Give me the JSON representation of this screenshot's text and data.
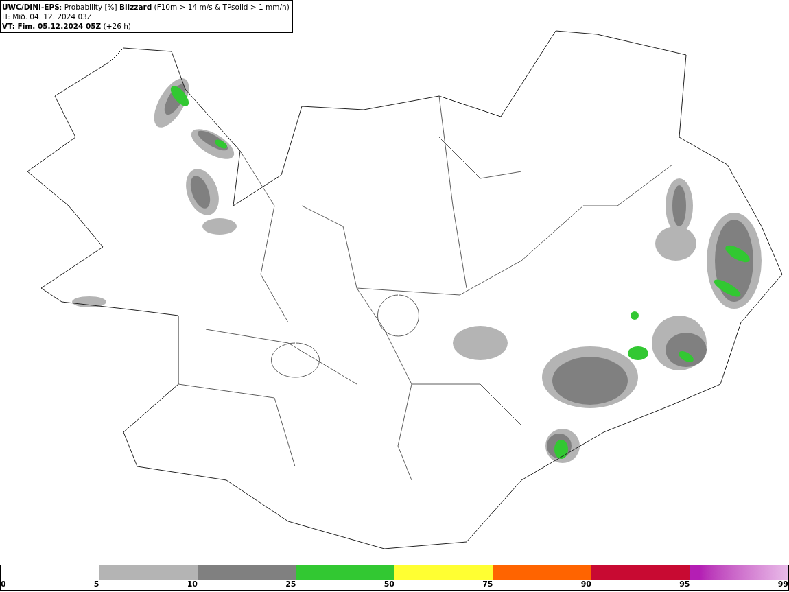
{
  "header": {
    "lines": [
      "**UWC/DINI-EPS**: Probability [%] **Blizzard** (F10m > 14 m/s & TPsolid > 1 mm/h)",
      "IT: Mið. 04. 12. 2024 03Z",
      "**VT: Fim. 05.12.2024 05Z** (+26 h)"
    ]
  },
  "legend": {
    "segments": [
      {
        "kind": "solid",
        "color": "#b4b4b4"
      },
      {
        "kind": "solid",
        "color": "#808080"
      },
      {
        "kind": "solid",
        "color": "#32c832"
      },
      {
        "kind": "solid",
        "color": "#ffff32"
      },
      {
        "kind": "solid",
        "color": "#ff6400"
      },
      {
        "kind": "solid",
        "color": "#c80a32"
      },
      {
        "kind": "gradient",
        "color": "#b41eb4"
      }
    ],
    "ticks": [
      "0",
      "5",
      "10",
      "25",
      "50",
      "75",
      "90",
      "95",
      "99"
    ]
  }
}
